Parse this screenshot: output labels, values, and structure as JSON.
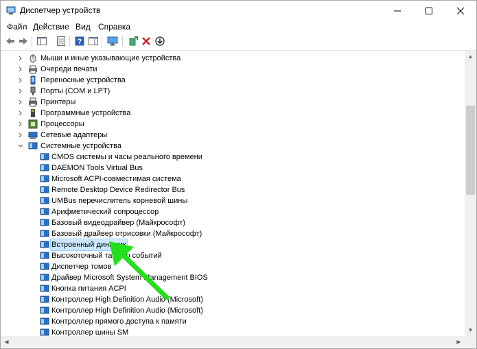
{
  "window": {
    "title": "Диспетчер устройств",
    "controls": {
      "minimize": "—",
      "maximize": "☐",
      "close": "✕"
    }
  },
  "menu": [
    {
      "label": "Файл"
    },
    {
      "label": "Действие"
    },
    {
      "label": "Вид"
    },
    {
      "label": "Справка"
    }
  ],
  "toolbar": {
    "buttons": [
      "back-icon",
      "forward-icon",
      "show-hide-tree-icon",
      "properties-icon",
      "help-icon",
      "console-tree-icon",
      "monitor-icon",
      "add-driver-icon",
      "uninstall-icon",
      "update-driver-icon"
    ]
  },
  "tree": {
    "categories": [
      {
        "label": "Мыши и иные указывающие устройства",
        "icon": "mouse-icon",
        "expanded": false
      },
      {
        "label": "Очереди печати",
        "icon": "print-queue-icon",
        "expanded": false
      },
      {
        "label": "Переносные устройства",
        "icon": "portable-device-icon",
        "expanded": false
      },
      {
        "label": "Порты (COM и LPT)",
        "icon": "port-icon",
        "expanded": false
      },
      {
        "label": "Принтеры",
        "icon": "printer-icon",
        "expanded": false
      },
      {
        "label": "Программные устройства",
        "icon": "software-device-icon",
        "expanded": false
      },
      {
        "label": "Процессоры",
        "icon": "processor-icon",
        "expanded": false
      },
      {
        "label": "Сетевые адаптеры",
        "icon": "network-adapter-icon",
        "expanded": false
      },
      {
        "label": "Системные устройства",
        "icon": "system-device-icon",
        "expanded": true
      }
    ],
    "system_devices": [
      {
        "label": "CMOS системы и часы реального времени"
      },
      {
        "label": "DAEMON Tools Virtual Bus"
      },
      {
        "label": "Microsoft ACPI-совместимая система"
      },
      {
        "label": "Remote Desktop Device Redirector Bus"
      },
      {
        "label": "UMBus перечислитель корневой шины"
      },
      {
        "label": "Арифметический сопроцессор"
      },
      {
        "label": "Базовый видеодрайвер (Майкрософт)"
      },
      {
        "label": "Базовый драйвер отрисовки (Майкрософт)"
      },
      {
        "label": "Встроенный динамик",
        "selected": true
      },
      {
        "label": "Высокоточный таймер событий"
      },
      {
        "label": "Диспетчер томов"
      },
      {
        "label": "Драйвер Microsoft System Management BIOS"
      },
      {
        "label": "Кнопка питания ACPI"
      },
      {
        "label": "Контроллер High Definition Audio (Microsoft)"
      },
      {
        "label": "Контроллер High Definition Audio (Microsoft)"
      },
      {
        "label": "Контроллер прямого доступа к памяти"
      },
      {
        "label": "Контроллер шины SM"
      }
    ]
  },
  "colors": {
    "selection_bg": "#cce8ff",
    "annotation_arrow": "#22e01a",
    "device_icon": "#1e7fc8"
  }
}
